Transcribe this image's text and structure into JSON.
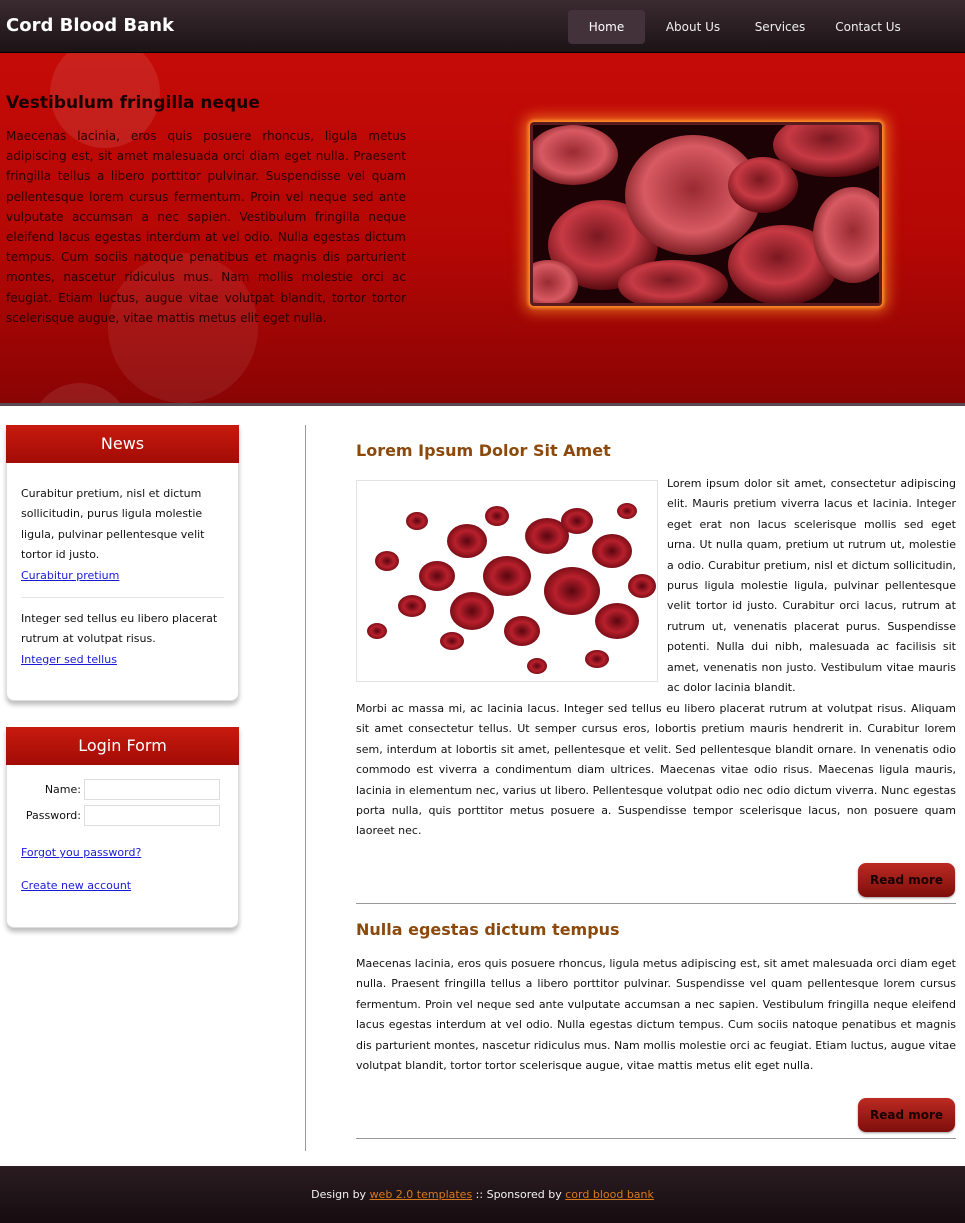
{
  "header": {
    "logo": "Cord Blood Bank",
    "nav": [
      "Home",
      "About Us",
      "Services",
      "Contact Us"
    ]
  },
  "banner": {
    "title": "Vestibulum fringilla neque",
    "text": "Maecenas lacinia, eros quis posuere rhoncus, ligula metus adipiscing est, sit amet malesuada orci diam eget nulla. Praesent fringilla tellus a libero porttitor pulvinar. Suspendisse vel quam pellentesque lorem cursus fermentum. Proin vel neque sed ante vulputate accumsan a nec sapien. Vestibulum fringilla neque eleifend lacus egestas interdum at vel odio. Nulla egestas dictum tempus. Cum sociis natoque penatibus et magnis dis parturient montes, nascetur ridiculus mus. Nam mollis molestie orci ac feugiat. Etiam luctus, augue vitae volutpat blandit, tortor tortor scelerisque augue, vitae mattis metus elit eget nulla."
  },
  "news": {
    "heading": "News",
    "items": [
      {
        "text": "Curabitur pretium, nisl et dictum sollicitudin, purus ligula molestie ligula, pulvinar pellentesque velit tortor id justo.",
        "link": "Curabitur pretium"
      },
      {
        "text": "Integer sed tellus eu libero placerat rutrum at volutpat risus.",
        "link": "Integer sed tellus"
      }
    ]
  },
  "login": {
    "heading": "Login Form",
    "name_label": "Name:",
    "password_label": "Password:",
    "forgot_link": "Forgot you password?",
    "create_link": "Create new account"
  },
  "posts": [
    {
      "title": "Lorem Ipsum Dolor Sit Amet",
      "text_side": "Lorem ipsum dolor sit amet, consectetur adipiscing elit. Mauris pretium viverra lacus et lacinia. Integer eget erat non lacus scelerisque mollis sed eget urna. Ut nulla quam, pretium ut rutrum ut, molestie a odio. Curabitur pretium, nisl et dictum sollicitudin, purus ligula molestie ligula, pulvinar pellentesque velit tortor id justo. Curabitur orci lacus, rutrum at rutrum ut, venenatis placerat purus. Suspendisse potenti. Nulla dui nibh, malesuada ac facilisis sit amet, venenatis non justo. Vestibulum vitae mauris ac dolor lacinia blandit.",
      "text_full": "Morbi ac massa mi, ac lacinia lacus. Integer sed tellus eu libero placerat rutrum at volutpat risus. Aliquam sit amet consectetur tellus. Ut semper cursus eros, lobortis pretium mauris hendrerit in. Curabitur lorem sem, interdum at lobortis sit amet, pellentesque et velit. Sed pellentesque blandit ornare. In venenatis odio commodo est viverra a condimentum diam ultrices. Maecenas vitae odio risus. Maecenas ligula mauris, lacinia in elementum nec, varius ut libero. Pellentesque volutpat odio nec odio dictum viverra. Nunc egestas porta nulla, quis porttitor metus posuere a. Suspendisse tempor scelerisque lacus, non posuere quam laoreet nec.",
      "read_more": "Read more"
    },
    {
      "title": "Nulla egestas dictum tempus",
      "text": "Maecenas lacinia, eros quis posuere rhoncus, ligula metus adipiscing est, sit amet malesuada orci diam eget nulla. Praesent fringilla tellus a libero porttitor pulvinar. Suspendisse vel quam pellentesque lorem cursus fermentum. Proin vel neque sed ante vulputate accumsan a nec sapien. Vestibulum fringilla neque eleifend lacus egestas interdum at vel odio. Nulla egestas dictum tempus. Cum sociis natoque penatibus et magnis dis parturient montes, nascetur ridiculus mus. Nam mollis molestie orci ac feugiat. Etiam luctus, augue vitae volutpat blandit, tortor tortor scelerisque augue, vitae mattis metus elit eget nulla.",
      "read_more": "Read more"
    }
  ],
  "footer": {
    "design_prefix": "Design by ",
    "design_link": "web 2.0 templates",
    "sponsor_prefix": " :: Sponsored by ",
    "sponsor_link": "cord blood bank"
  }
}
